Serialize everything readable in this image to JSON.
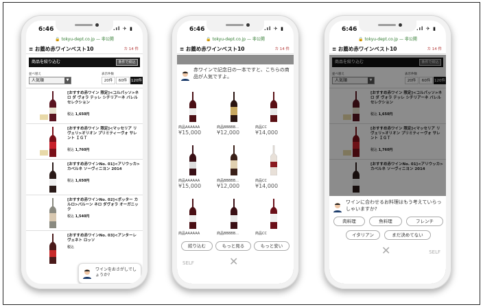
{
  "status": {
    "time": "6:46",
    "indicators": ".ıl ✈ ▮"
  },
  "browser": {
    "url": "🔒 tokyu-dept.co.jp — 非公開"
  },
  "page_title": "お薦め赤ワインベスト10",
  "cart_badge": "カ 14 件",
  "filter": {
    "label": "商品を絞り込む",
    "condition_button": "条件で絞込"
  },
  "sort": {
    "label": "並べ替え",
    "selected": "人気順"
  },
  "count": {
    "label": "表示件数",
    "options": [
      "20件",
      "60件",
      "120件"
    ],
    "selected": "120件"
  },
  "products": [
    {
      "name": "[おすすめ赤ワイン 限定]<コルパッソ>ネロ ダ ヴォラ テッレ シチリアーネ バレルセレクション",
      "price_prefix": "税込",
      "price": "1,650円",
      "color": "#5a1420"
    },
    {
      "name": "[おすすめ赤ワイン 限定]<マッセリア リ ヴェリ>オリオン プリミティーヴォ サレント ＩＧＴ",
      "price_prefix": "税込",
      "price": "1,760円",
      "color": "#7a0f18"
    },
    {
      "name": "[おすすめ赤ワインNo. 01]<アリウッカ>カベルネ ソーヴィニヨン 2014",
      "price_prefix": "税込",
      "price": "1,650円",
      "color": "#2a1a18"
    },
    {
      "name": "[おすすめ赤ワインNo. 02]<ポッター カルロ>バルーン ネロ ダヴォラ オーガニック",
      "price_prefix": "税込",
      "price": "1,540円",
      "color": "#6a6a60"
    },
    {
      "name": "[おすすめ赤ワインNo. 03]<アンターレヴェネト ロッソ",
      "price_prefix": "税込",
      "price": "",
      "color": "#4a1a1a"
    }
  ],
  "chat1": {
    "message": "ワインをおさがしでしょうか?"
  },
  "chat2": {
    "message": "赤ワインで記念日の一本ですと、こちらの商品が人気ですよ。",
    "items": [
      {
        "label": "商品AAAAAA",
        "price": "¥15,000",
        "color": "#4a0f14"
      },
      {
        "label": "商品BBBBB...",
        "price": "¥12,000",
        "color": "#2a1410"
      },
      {
        "label": "商品CC",
        "price": "¥14,000",
        "color": "#5a0f14"
      },
      {
        "label": "商品AAAAAA",
        "price": "¥15,000",
        "color": "#3a1016"
      },
      {
        "label": "商品BBBBB...",
        "price": "¥12,000",
        "color": "#3a2018"
      },
      {
        "label": "商品CC",
        "price": "¥14,000",
        "color": "#e0d8d0"
      },
      {
        "label": "商品AAAAAA",
        "price": "",
        "color": "#4a0f14"
      },
      {
        "label": "商品BBBBB...",
        "price": "",
        "color": "#3a0f14"
      },
      {
        "label": "商品CC",
        "price": "",
        "color": "#6a0f18"
      }
    ],
    "buttons": [
      "絞り込む",
      "もっと見る",
      "もっと安い"
    ],
    "self_label": "SELF",
    "close": "✕"
  },
  "chat3": {
    "message": "ワインに合わせるお料理はもう考えていらっしゃいますか?",
    "options": [
      "肉料理",
      "魚料理",
      "フレンチ",
      "イタリアン",
      "まだ決めてない"
    ],
    "self_label": "SELF",
    "close": "✕"
  }
}
